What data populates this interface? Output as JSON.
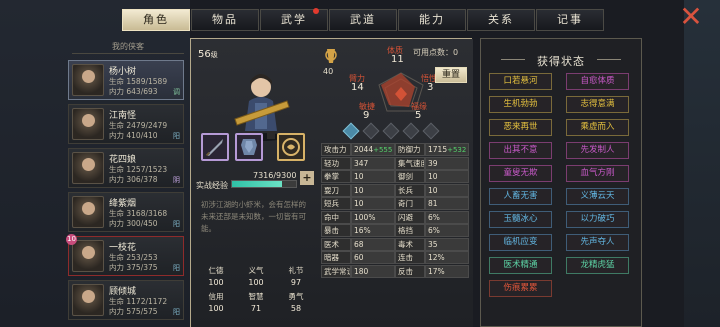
{
  "tabs": [
    {
      "label": "角色",
      "active": true
    },
    {
      "label": "物品",
      "active": false
    },
    {
      "label": "武学",
      "active": false,
      "dot": true
    },
    {
      "label": "武道",
      "active": false
    },
    {
      "label": "能力",
      "active": false
    },
    {
      "label": "关系",
      "active": false
    },
    {
      "label": "记事",
      "active": false
    }
  ],
  "close_label": "✕",
  "list_header": "我的侠客",
  "heroes": [
    {
      "name": "杨小树",
      "hp": "生命  1589/1589",
      "mp": "内力  643/693",
      "tag": "调",
      "active": true
    },
    {
      "name": "江南怪",
      "hp": "生命  2479/2479",
      "mp": "内力  410/410",
      "tag": "阳"
    },
    {
      "name": "花四娘",
      "hp": "生命  1257/1523",
      "mp": "内力  306/378",
      "tag": "阴"
    },
    {
      "name": "绛紫烟",
      "hp": "生命  3168/3168",
      "mp": "内力  300/450",
      "tag": "阳"
    },
    {
      "name": "一枝花",
      "hp": "生命  253/253",
      "mp": "内力  375/375",
      "tag": "阳",
      "alert": true,
      "badge": "10"
    },
    {
      "name": "顾倾城",
      "hp": "生命  1172/1172",
      "mp": "内力  575/575",
      "tag": "阳"
    }
  ],
  "character": {
    "level": "56",
    "level_suffix": "级",
    "exp_label": "实战经验",
    "exp_text": "7316/9300",
    "exp_fraction": 0.787,
    "exp_plus": "+",
    "bio": "初涉江湖的小虾米，会有怎样的未来还部是未知数，一切皆有可能。",
    "vitals": [
      {
        "label": "仁德",
        "value": "100"
      },
      {
        "label": "义气",
        "value": "100"
      },
      {
        "label": "礼节",
        "value": "97"
      },
      {
        "label": "信用",
        "value": "100"
      },
      {
        "label": "智慧",
        "value": "71"
      },
      {
        "label": "勇气",
        "value": "58"
      }
    ]
  },
  "radar": {
    "badge_value": "40",
    "points_label": "可用点数：0",
    "reset_label": "重置",
    "attrs": [
      {
        "label": "体质",
        "value": "11"
      },
      {
        "label": "臂力",
        "value": "14"
      },
      {
        "label": "悟性",
        "value": "3"
      },
      {
        "label": "敏捷",
        "value": "9"
      },
      {
        "label": "福缘",
        "value": "5"
      }
    ]
  },
  "stats": [
    [
      "攻击力",
      "2044",
      "+555",
      "防御力",
      "1715",
      "+532"
    ],
    [
      "轻功",
      "347",
      "",
      "集气速度",
      "39",
      ""
    ],
    [
      "拳掌",
      "10",
      "",
      "御剑",
      "10",
      ""
    ],
    [
      "耍刀",
      "10",
      "",
      "长兵",
      "10",
      ""
    ],
    [
      "短兵",
      "10",
      "",
      "奇门",
      "81",
      ""
    ],
    [
      "命中",
      "100%",
      "",
      "闪避",
      "6%",
      ""
    ],
    [
      "暴击",
      "16%",
      "",
      "格挡",
      "6%",
      ""
    ],
    [
      "医术",
      "68",
      "",
      "毒术",
      "35",
      ""
    ],
    [
      "暗器",
      "60",
      "",
      "连击",
      "12%",
      ""
    ],
    [
      "武学常识",
      "180",
      "",
      "反击",
      "17%",
      ""
    ]
  ],
  "states_title": "获得状态",
  "states": [
    {
      "label": "口若悬河",
      "color": "yellow"
    },
    {
      "label": "自愈体质",
      "color": "purple"
    },
    {
      "label": "生机勃勃",
      "color": "yellow"
    },
    {
      "label": "志得意满",
      "color": "yellow"
    },
    {
      "label": "恶来再世",
      "color": "yellow"
    },
    {
      "label": "乘虚而入",
      "color": "yellow"
    },
    {
      "label": "出其不意",
      "color": "purple"
    },
    {
      "label": "先发制人",
      "color": "purple"
    },
    {
      "label": "童叟无欺",
      "color": "purple"
    },
    {
      "label": "血气方刚",
      "color": "purple"
    },
    {
      "label": "人畜无害",
      "color": "blue"
    },
    {
      "label": "义薄云天",
      "color": "blue"
    },
    {
      "label": "玉髓冰心",
      "color": "blue"
    },
    {
      "label": "以力破巧",
      "color": "blue"
    },
    {
      "label": "临机应变",
      "color": "blue"
    },
    {
      "label": "先声夺人",
      "color": "blue"
    },
    {
      "label": "医术精通",
      "color": "green"
    },
    {
      "label": "龙精虎猛",
      "color": "green"
    },
    {
      "label": "伤痕累累",
      "color": "red"
    }
  ]
}
